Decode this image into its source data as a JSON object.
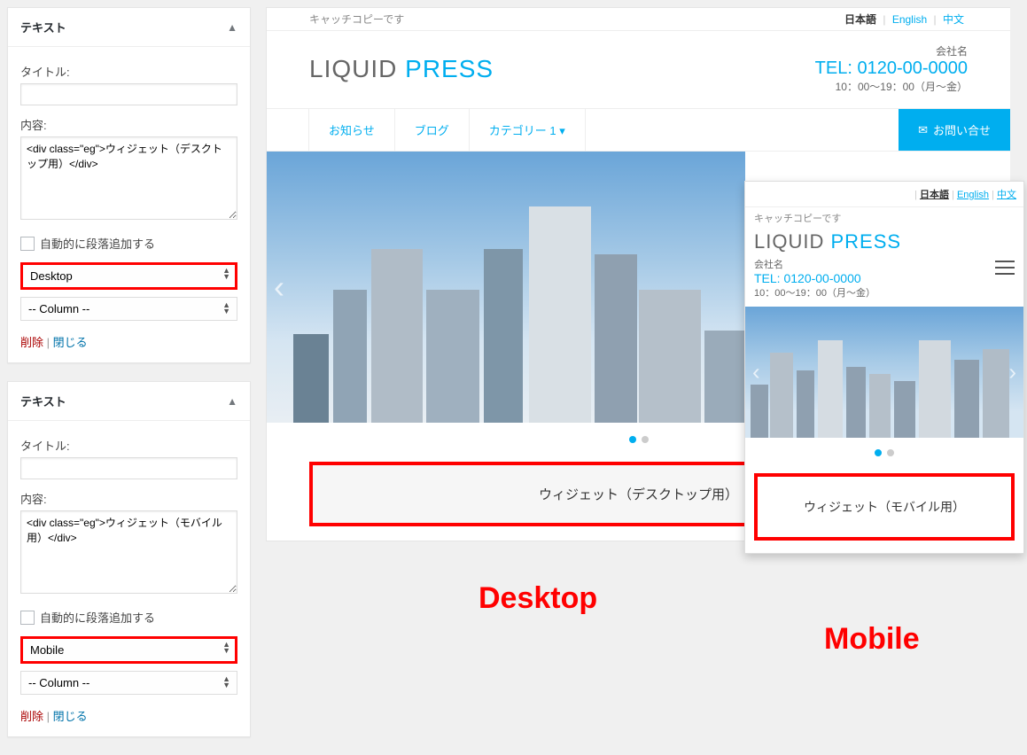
{
  "widgets": [
    {
      "header": "テキスト",
      "title_label": "タイトル:",
      "title_value": "",
      "content_label": "内容:",
      "content_value": "<div class=\"eg\">ウィジェット（デスクトップ用）</div>",
      "auto_paragraph_label": "自動的に段落追加する",
      "device_value": "Desktop",
      "column_value": "-- Column --",
      "delete_label": "削除",
      "close_label": "閉じる"
    },
    {
      "header": "テキスト",
      "title_label": "タイトル:",
      "title_value": "",
      "content_label": "内容:",
      "content_value": "<div class=\"eg\">ウィジェット（モバイル用）</div>",
      "auto_paragraph_label": "自動的に段落追加する",
      "device_value": "Mobile",
      "column_value": "-- Column --",
      "delete_label": "削除",
      "close_label": "閉じる"
    }
  ],
  "preview": {
    "catch_copy": "キャッチコピーです",
    "lang": {
      "ja": "日本語",
      "en": "English",
      "zh": "中文"
    },
    "logo_part1": "LIQUID ",
    "logo_part2": "PRESS",
    "company_name": "会社名",
    "tel_label": "TEL: 0120-00-0000",
    "hours": "10：00〜19：00（月〜金）",
    "nav": {
      "news": "お知らせ",
      "blog": "ブログ",
      "cat": "カテゴリー 1",
      "contact": "お問い合せ"
    },
    "desktop_widget_text": "ウィジェット（デスクトップ用）",
    "mobile_widget_text": "ウィジェット（モバイル用）"
  },
  "labels": {
    "desktop": "Desktop",
    "mobile": "Mobile"
  }
}
